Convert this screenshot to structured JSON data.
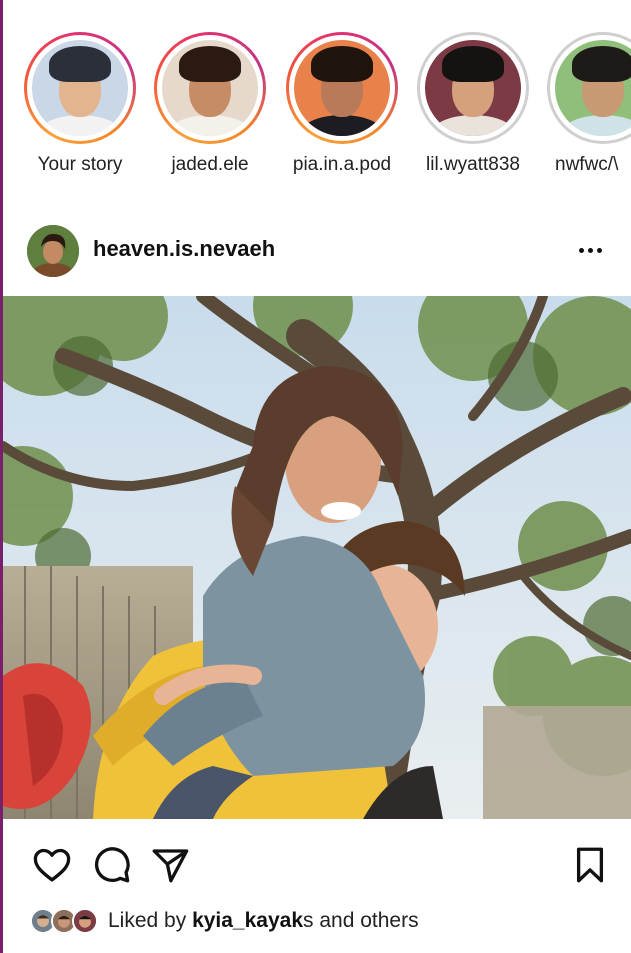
{
  "stories": [
    {
      "label": "Your story",
      "ring": "gradient",
      "skin": "#e2b58f",
      "hair": "#2a2f3a",
      "bg": "#c9d7e6",
      "shirt": "#f2f2f2"
    },
    {
      "label": "jaded.ele",
      "ring": "gradient",
      "skin": "#c68c66",
      "hair": "#2b1a12",
      "bg": "#e6d9cc",
      "shirt": "#f4f1ea"
    },
    {
      "label": "pia.in.a.pod",
      "ring": "gradient",
      "skin": "#b87a58",
      "hair": "#1f140e",
      "bg": "#e8824a",
      "shirt": "#1c1c22"
    },
    {
      "label": "lil.wyatt838",
      "ring": "seen",
      "skin": "#d5a17c",
      "hair": "#151212",
      "bg": "#7b3a44",
      "shirt": "#eae3dc"
    },
    {
      "label": "nwfwc/\\",
      "ring": "seen",
      "skin": "#c89a74",
      "hair": "#1e1a17",
      "bg": "#8fbf7a",
      "shirt": "#cfe2e8"
    }
  ],
  "post": {
    "username": "heaven.is.nevaeh",
    "more_icon": "more-horizontal-icon",
    "image_alt": "Two people laughing under a tree, one riding piggyback on the other"
  },
  "actions": {
    "like_icon": "heart-icon",
    "comment_icon": "comment-icon",
    "share_icon": "send-icon",
    "save_icon": "bookmark-icon"
  },
  "likes": {
    "prefix": "Liked by ",
    "user": "kyia_kayak",
    "suffix": "s and others"
  },
  "colors": {
    "ring_gradient_start": "#f9a23a",
    "ring_gradient_end": "#c13584",
    "ring_seen": "#cfcfcf",
    "accent_edge": "#7a1f6a"
  }
}
